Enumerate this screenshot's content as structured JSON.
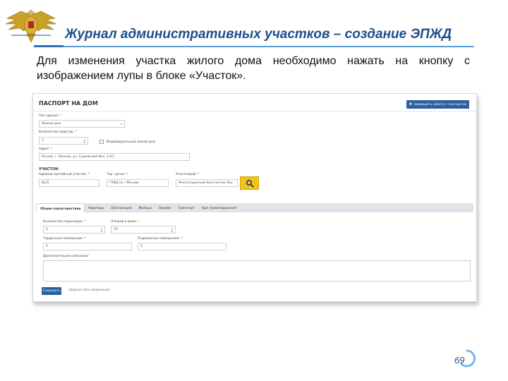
{
  "slide": {
    "title": "Журнал административных участков – создание ЭПЖД",
    "instruction": "Для изменения участка жилого дома необходимо нажать на кнопку с изображением лупы в блоке «Участок».",
    "page_number": "69",
    "emblem_icon": "double-headed-eagle-emblem"
  },
  "colors": {
    "title": "#1f4e8c",
    "rule": "#5b9bd5",
    "primary_button": "#2c5f9e",
    "highlight": "#f2c319"
  },
  "form": {
    "heading": "ПАСПОРТ НА ДОМ",
    "return_button": "Завершить работу с паспортом",
    "return_icon": "close-icon",
    "building_type": {
      "label": "Тип здания:",
      "value": "Жилой дом"
    },
    "apartments_count": {
      "label": "Количество квартир:",
      "value": "5"
    },
    "single_family_checkbox": {
      "label": "Индивидуальный жилой дом",
      "checked": false
    },
    "address": {
      "label": "Адрес:",
      "value": "Россия, г. Москва, ул. Сущевский Вал, 13с1"
    },
    "section_title": "УЧАСТОК:",
    "admin_district": {
      "label": "Административный участок:",
      "value": "№15"
    },
    "territorial_body": {
      "label": "Тер. орган:",
      "value": "ГУВД по г.Москве"
    },
    "officer": {
      "label": "Участковый:",
      "value": "Многозадачный Константин Вас"
    },
    "search_icon": "magnifier-icon",
    "tabs": [
      {
        "label": "Общие характеристики",
        "active": true
      },
      {
        "label": "Квартиры",
        "active": false
      },
      {
        "label": "Организации",
        "active": false
      },
      {
        "label": "Жильцы",
        "active": false
      },
      {
        "label": "Оружие",
        "active": false
      },
      {
        "label": "Транспорт",
        "active": false
      },
      {
        "label": "Адм. правонарушения",
        "active": false
      }
    ],
    "entrances": {
      "label": "Количество подъездов:",
      "value": "4"
    },
    "floors": {
      "label": "Этажей в доме:",
      "value": "10"
    },
    "attic_rooms": {
      "label": "Чердачные помещения:",
      "value": "0"
    },
    "basement_rooms": {
      "label": "Подвальные помещения:",
      "value": "5"
    },
    "extra_description": {
      "label": "Дополнительное описание:",
      "value": ""
    },
    "save_button": "Сохранить",
    "close_without_saving": "Закрыть без сохранения"
  }
}
